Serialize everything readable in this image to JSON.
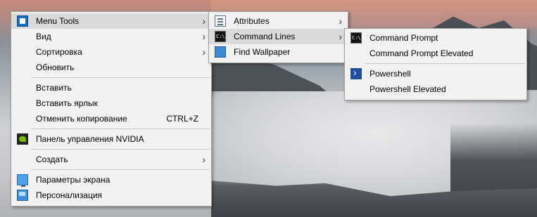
{
  "main_menu": {
    "items": [
      {
        "label": "Menu Tools",
        "icon": "menu-tools-icon",
        "submenu": true
      },
      {
        "label": "Вид",
        "submenu": true
      },
      {
        "label": "Сортировка",
        "submenu": true
      },
      {
        "label": "Обновить"
      },
      {
        "label": "Вставить"
      },
      {
        "label": "Вставить ярлык"
      },
      {
        "label": "Отменить копирование",
        "shortcut": "CTRL+Z"
      },
      {
        "label": "Панель управления NVIDIA",
        "icon": "nvidia-icon"
      },
      {
        "label": "Создать",
        "submenu": true
      },
      {
        "label": "Параметры экрана",
        "icon": "display-settings-icon"
      },
      {
        "label": "Персонализация",
        "icon": "personalization-icon"
      }
    ]
  },
  "submenu_tools": {
    "items": [
      {
        "label": "Attributes",
        "icon": "attributes-icon",
        "submenu": true
      },
      {
        "label": "Command Lines",
        "icon": "command-prompt-icon",
        "submenu": true
      },
      {
        "label": "Find Wallpaper",
        "icon": "wallpaper-icon"
      }
    ]
  },
  "submenu_cmd": {
    "items": [
      {
        "label": "Command Prompt",
        "icon": "command-prompt-icon"
      },
      {
        "label": "Command Prompt Elevated"
      },
      {
        "label": "Powershell",
        "icon": "powershell-icon"
      },
      {
        "label": "Powershell Elevated"
      }
    ]
  },
  "colors": {
    "menu_bg": "#f2f2f2",
    "highlight": "#dadada",
    "separator": "#c8c8c8"
  }
}
